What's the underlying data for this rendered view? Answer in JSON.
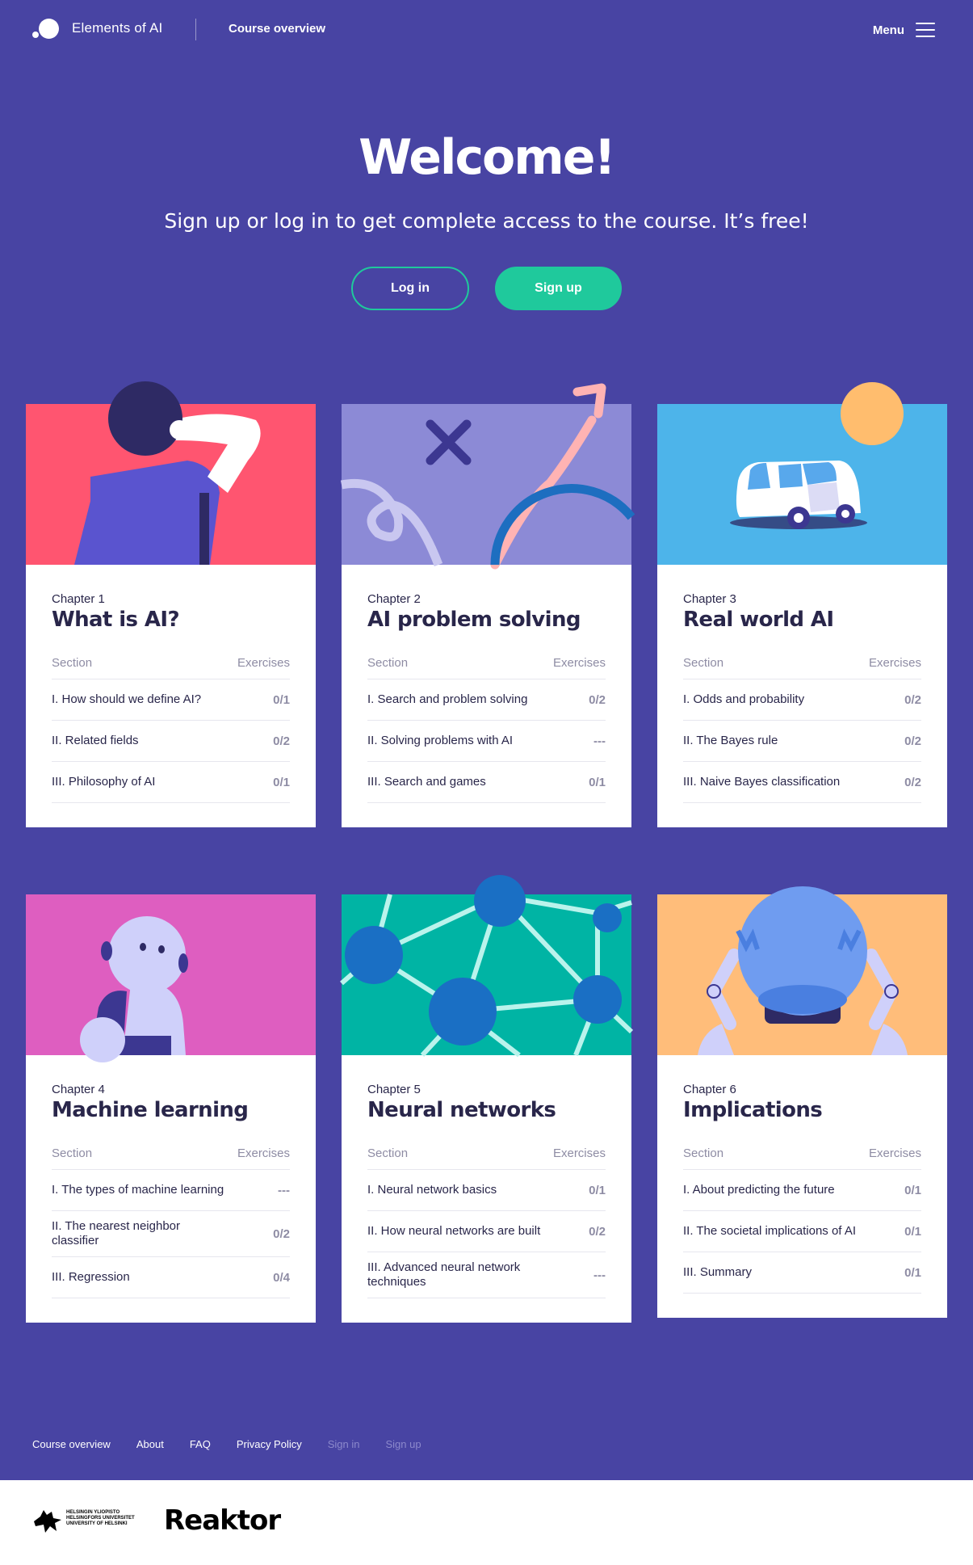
{
  "header": {
    "brand": "Elements of AI",
    "course_overview": "Course overview",
    "menu": "Menu"
  },
  "hero": {
    "title": "Welcome!",
    "subtitle": "Sign up or log in to get complete access to the course. It’s free!",
    "login": "Log in",
    "signup": "Sign up"
  },
  "colors": {
    "background": "#4844a3",
    "accent_green": "#1fc99c",
    "card_text": "#29264a"
  },
  "chapters": [
    {
      "number": "Chapter 1",
      "title": "What is AI?",
      "illustration": "person-thinking",
      "section_header": "Section",
      "exercises_header": "Exercises",
      "rows": [
        {
          "section": "I. How should we define AI?",
          "exercises": "0/1"
        },
        {
          "section": "II. Related fields",
          "exercises": "0/2"
        },
        {
          "section": "III. Philosophy of AI",
          "exercises": "0/1"
        }
      ]
    },
    {
      "number": "Chapter 2",
      "title": "AI problem solving",
      "illustration": "arrows-and-paths",
      "section_header": "Section",
      "exercises_header": "Exercises",
      "rows": [
        {
          "section": "I. Search and problem solving",
          "exercises": "0/2"
        },
        {
          "section": "II. Solving problems with AI",
          "exercises": "---"
        },
        {
          "section": "III. Search and games",
          "exercises": "0/1"
        }
      ]
    },
    {
      "number": "Chapter 3",
      "title": "Real world AI",
      "illustration": "self-driving-car",
      "section_header": "Section",
      "exercises_header": "Exercises",
      "rows": [
        {
          "section": "I. Odds and probability",
          "exercises": "0/2"
        },
        {
          "section": "II. The Bayes rule",
          "exercises": "0/2"
        },
        {
          "section": "III. Naive Bayes classification",
          "exercises": "0/2"
        }
      ]
    },
    {
      "number": "Chapter 4",
      "title": "Machine learning",
      "illustration": "robot-thinking",
      "section_header": "Section",
      "exercises_header": "Exercises",
      "rows": [
        {
          "section": "I. The types of machine learning",
          "exercises": "---"
        },
        {
          "section": "II. The nearest neighbor classifier",
          "exercises": "0/2"
        },
        {
          "section": "III. Regression",
          "exercises": "0/4"
        }
      ]
    },
    {
      "number": "Chapter 5",
      "title": "Neural networks",
      "illustration": "network-graph",
      "section_header": "Section",
      "exercises_header": "Exercises",
      "rows": [
        {
          "section": "I. Neural network basics",
          "exercises": "0/1"
        },
        {
          "section": "II. How neural networks are built",
          "exercises": "0/2"
        },
        {
          "section": "III. Advanced neural network techniques",
          "exercises": "---"
        }
      ]
    },
    {
      "number": "Chapter 6",
      "title": "Implications",
      "illustration": "robot-crystal-ball",
      "section_header": "Section",
      "exercises_header": "Exercises",
      "rows": [
        {
          "section": "I. About predicting the future",
          "exercises": "0/1"
        },
        {
          "section": "II. The societal implications of AI",
          "exercises": "0/1"
        },
        {
          "section": "III. Summary",
          "exercises": "0/1"
        }
      ]
    }
  ],
  "footer": {
    "links": [
      "Course overview",
      "About",
      "FAQ",
      "Privacy Policy",
      "Sign in",
      "Sign up"
    ],
    "partners": {
      "university_line1": "HELSINGIN YLIOPISTO",
      "university_line2": "HELSINGFORS UNIVERSITET",
      "university_line3": "UNIVERSITY OF HELSINKI",
      "company": "Reaktor"
    }
  }
}
